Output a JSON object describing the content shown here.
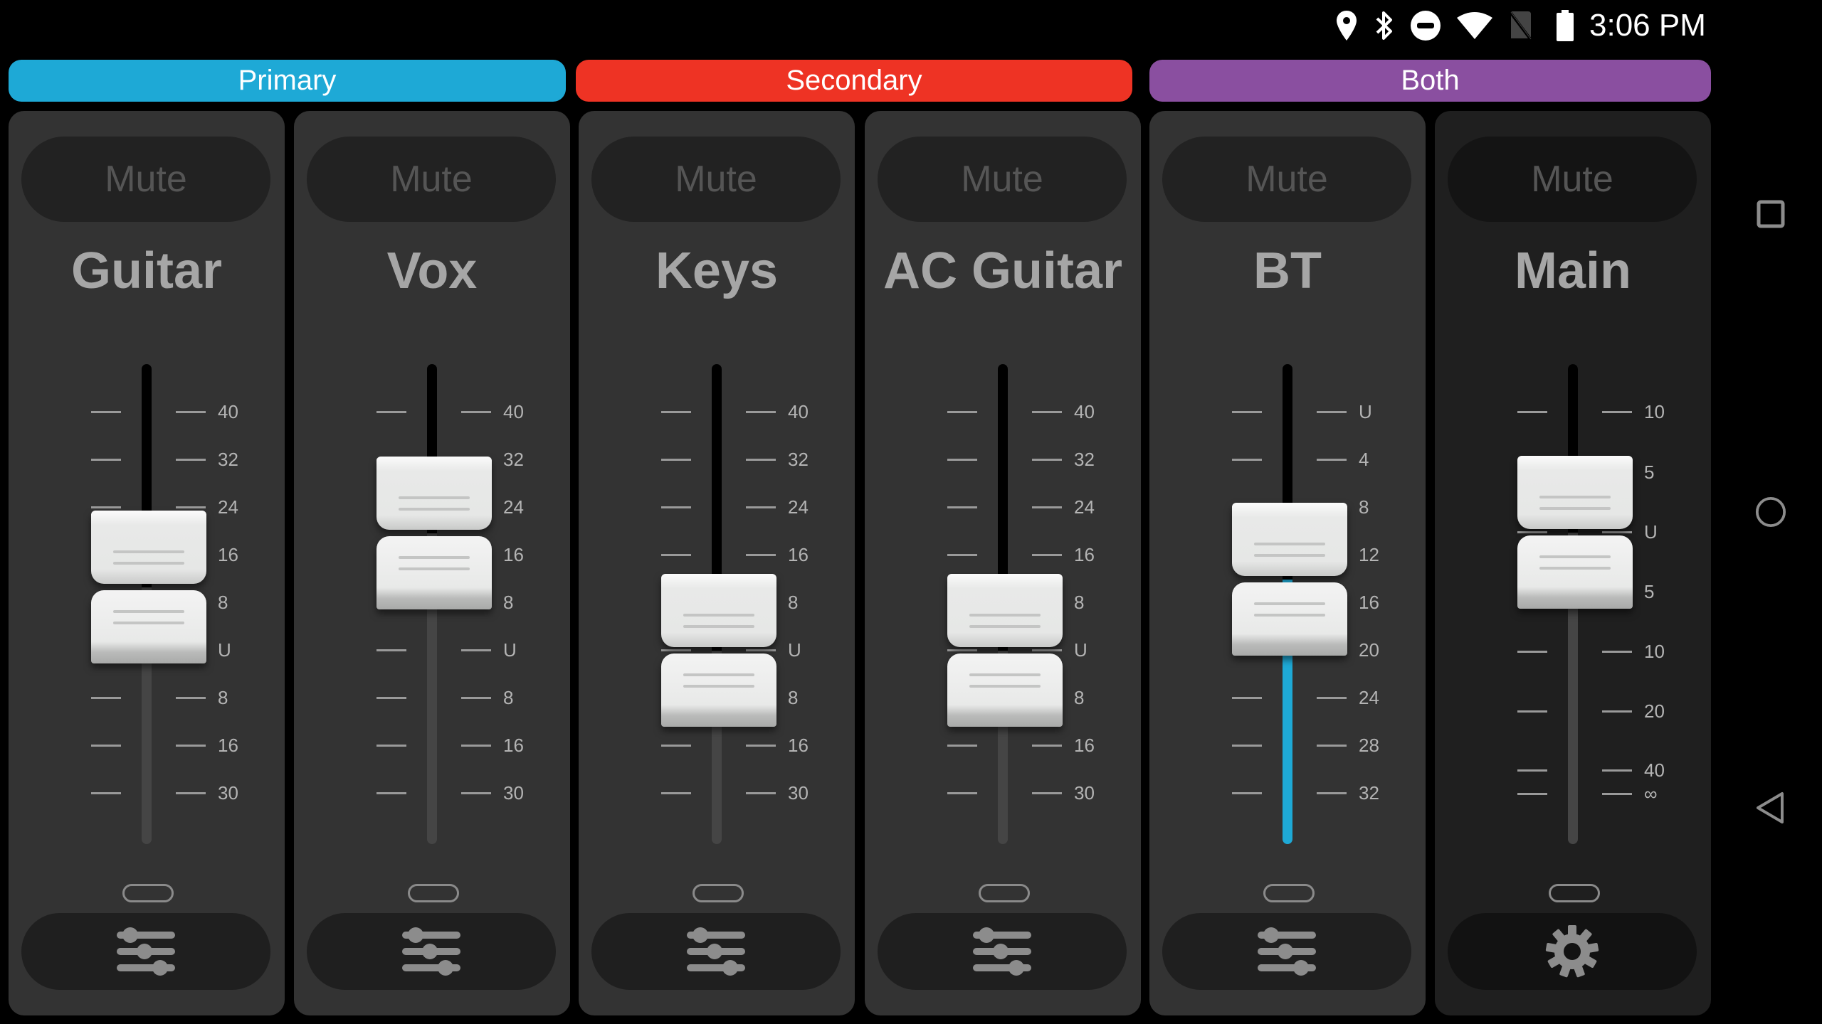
{
  "status_bar": {
    "icons": [
      "location-icon",
      "bluetooth-icon",
      "do-not-disturb-icon",
      "wifi-icon",
      "no-sim-icon",
      "battery-icon"
    ],
    "time": "3:06 PM"
  },
  "groups": [
    {
      "label": "Primary",
      "color": "#1ea9d6"
    },
    {
      "label": "Secondary",
      "color": "#ee3324"
    },
    {
      "label": "Both",
      "color": "#8a4fa0"
    }
  ],
  "strips": [
    {
      "name": "Guitar",
      "mute_label": "Mute",
      "fader_value": "8",
      "scale": [
        "40",
        "32",
        "24",
        "16",
        "8",
        "U",
        "8",
        "16",
        "30"
      ],
      "fill_color": null,
      "bottom_icon": "sliders-icon"
    },
    {
      "name": "Vox",
      "mute_label": "Mute",
      "fader_value": "20",
      "scale": [
        "40",
        "32",
        "24",
        "16",
        "8",
        "U",
        "8",
        "16",
        "30"
      ],
      "fill_color": null,
      "bottom_icon": "sliders-icon"
    },
    {
      "name": "Keys",
      "mute_label": "Mute",
      "fader_value": "U",
      "scale": [
        "40",
        "32",
        "24",
        "16",
        "8",
        "U",
        "8",
        "16",
        "30"
      ],
      "fill_color": null,
      "bottom_icon": "sliders-icon"
    },
    {
      "name": "AC Guitar",
      "mute_label": "Mute",
      "fader_value": "U",
      "scale": [
        "40",
        "32",
        "24",
        "16",
        "8",
        "U",
        "8",
        "16",
        "30"
      ],
      "fill_color": null,
      "bottom_icon": "sliders-icon"
    },
    {
      "name": "BT",
      "mute_label": "Mute",
      "fader_value": "14",
      "scale": [
        "U",
        "4",
        "8",
        "12",
        "16",
        "20",
        "24",
        "28",
        "32"
      ],
      "fill_color": "#1ea9d6",
      "bottom_icon": "sliders-icon"
    },
    {
      "name": "Main",
      "mute_label": "Mute",
      "fader_value": "U",
      "scale": [
        "10",
        "5",
        "U",
        "5",
        "10",
        "20",
        "40",
        "∞"
      ],
      "fill_color": null,
      "bottom_icon": "gear-icon"
    }
  ],
  "nav": [
    "recents-icon",
    "home-icon",
    "back-icon"
  ]
}
